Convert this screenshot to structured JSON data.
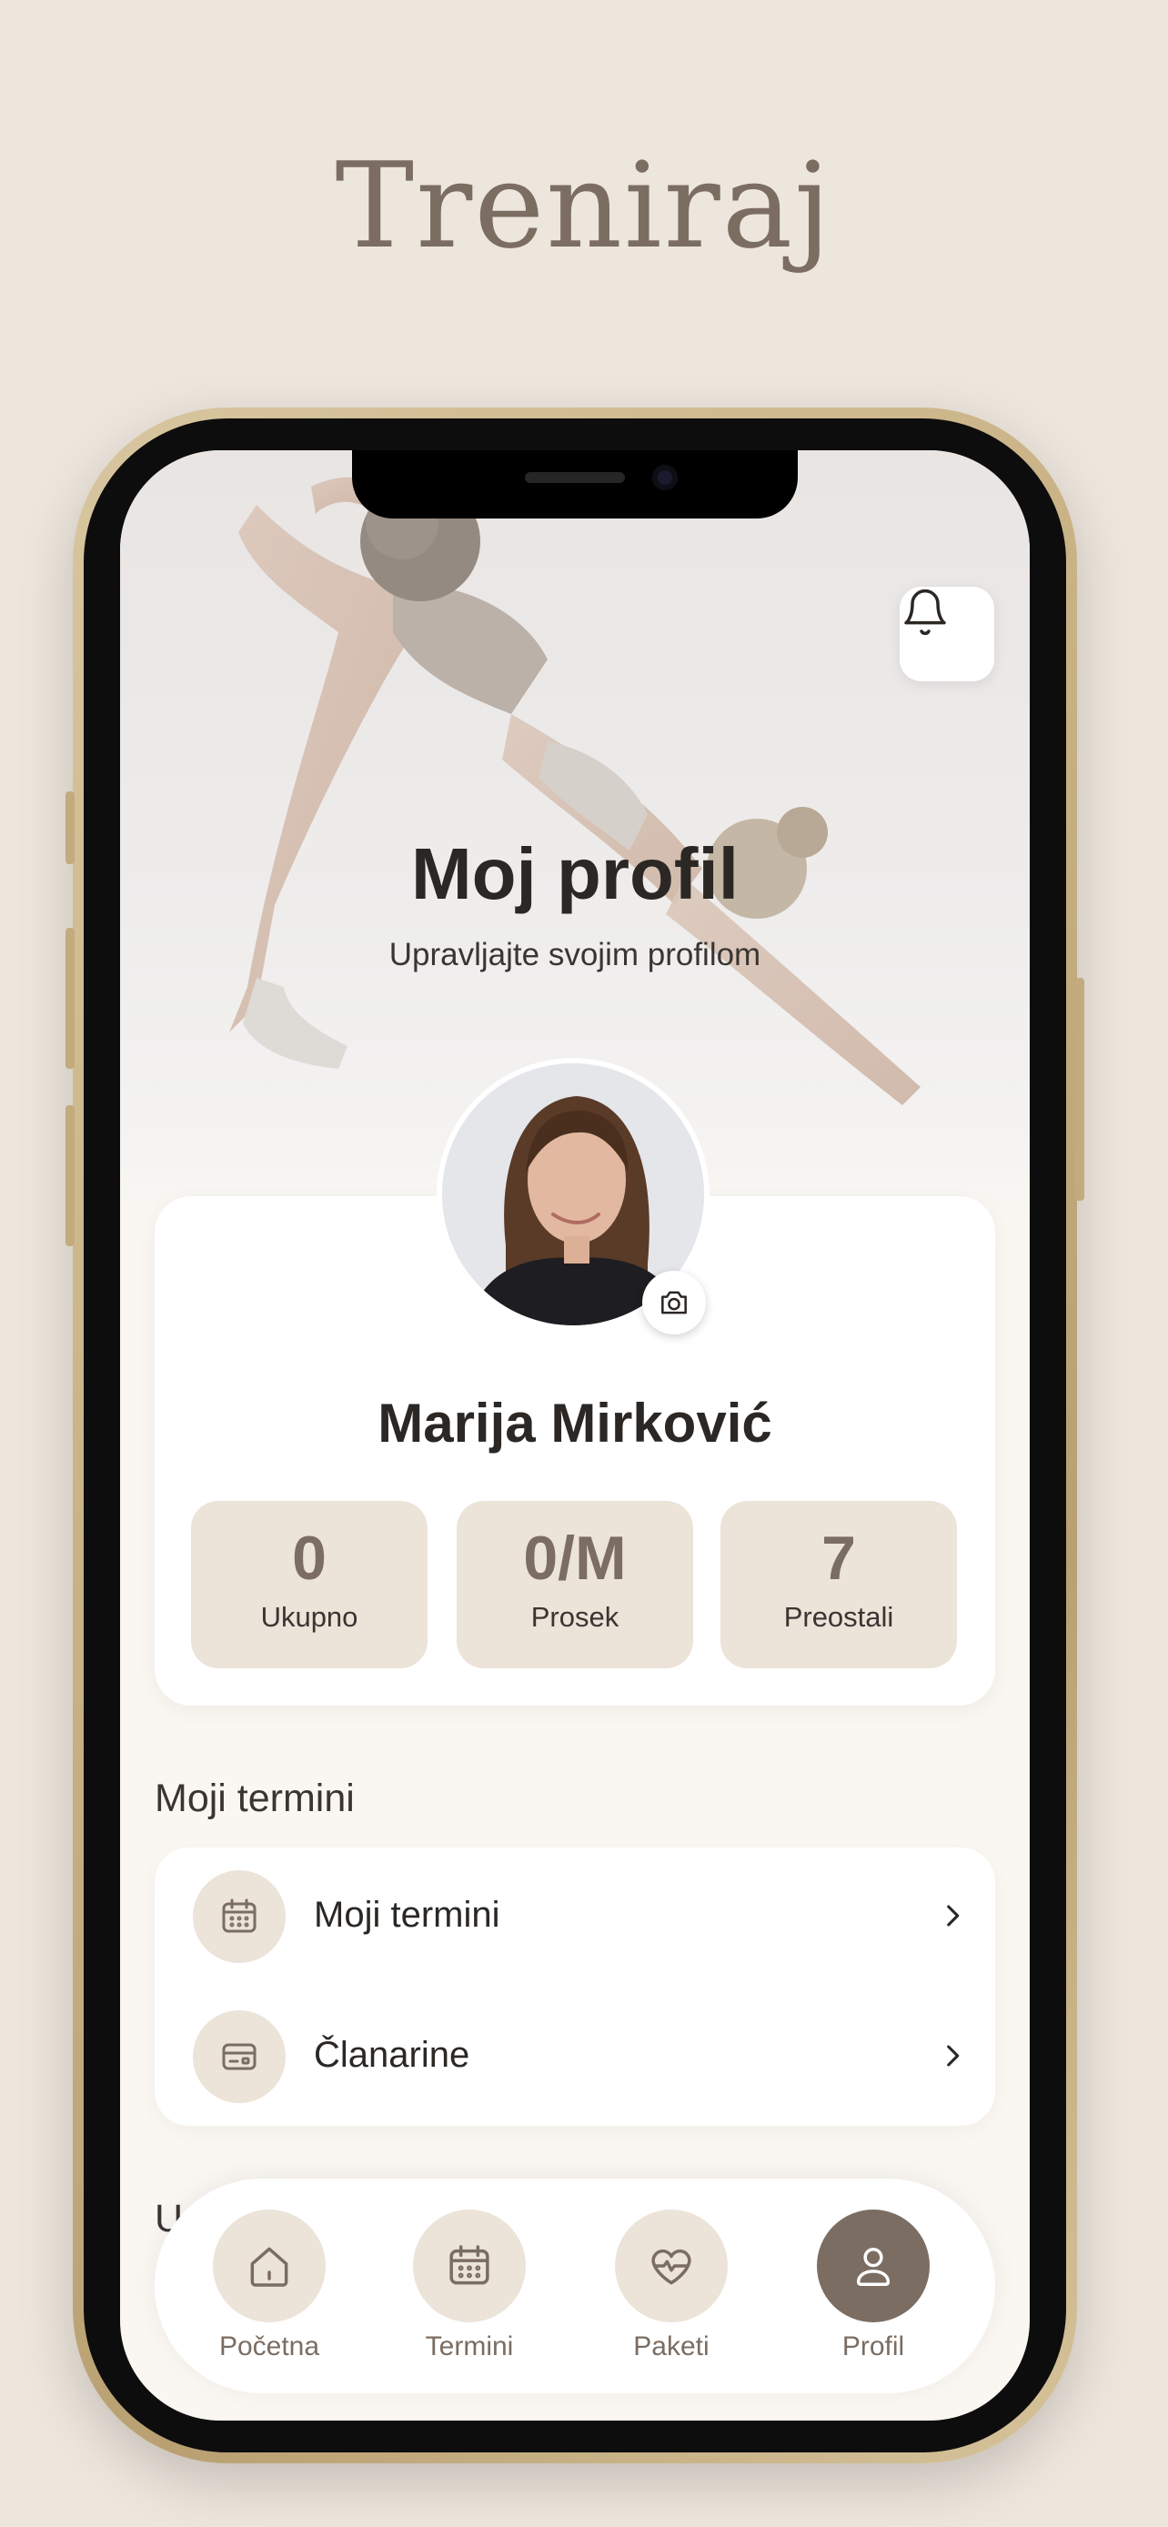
{
  "headline": "Treniraj",
  "hero": {
    "title": "Moj profil",
    "subtitle": "Upravljajte svojim profilom"
  },
  "profile": {
    "name": "Marija Mirković",
    "stats": [
      {
        "value": "0",
        "label": "Ukupno"
      },
      {
        "value": "0/M",
        "label": "Prosek"
      },
      {
        "value": "7",
        "label": "Preostali"
      }
    ]
  },
  "section": {
    "title": "Moji termini",
    "items": [
      {
        "label": "Moji termini",
        "icon": "calendar-icon"
      },
      {
        "label": "Članarine",
        "icon": "card-icon"
      }
    ],
    "next_section_peek": "U"
  },
  "nav": {
    "items": [
      {
        "label": "Početna",
        "icon": "home-icon"
      },
      {
        "label": "Termini",
        "icon": "calendar-icon"
      },
      {
        "label": "Paketi",
        "icon": "heart-pulse-icon"
      },
      {
        "label": "Profil",
        "icon": "user-icon",
        "active": true
      }
    ]
  },
  "colors": {
    "background": "#ede6dd",
    "accent": "#7b6d62",
    "chip": "#ece3d9",
    "text": "#2b2724"
  }
}
